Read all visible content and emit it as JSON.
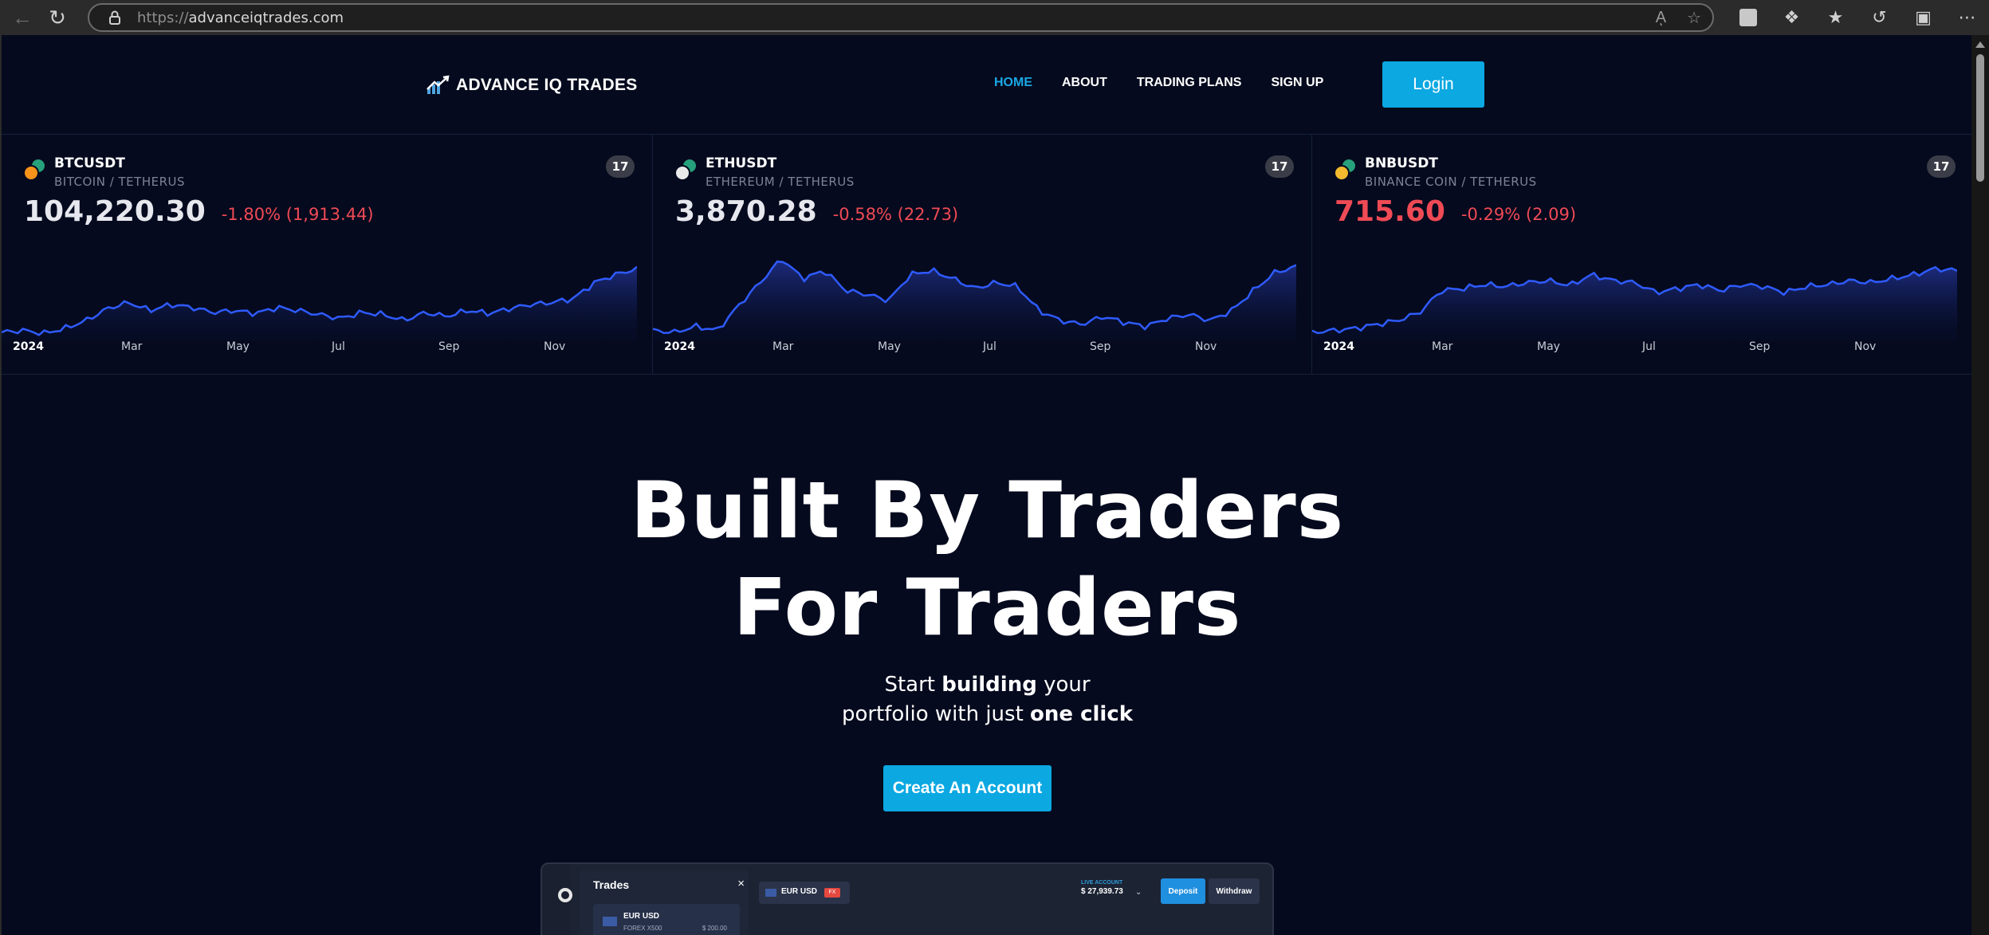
{
  "browser": {
    "url_scheme": "https://",
    "url_host": "advanceiqtrades.com",
    "read_aloud_label": "Aͅ",
    "icons": [
      "back-icon",
      "refresh-icon",
      "lock-icon",
      "read-aloud-icon",
      "favorite-star-icon",
      "profile-icon",
      "extensions-icon",
      "favorites-icon",
      "history-icon",
      "screen-capture-icon",
      "more-icon"
    ]
  },
  "site": {
    "brand": "ADVANCE IQ TRADES",
    "nav": [
      "HOME",
      "ABOUT",
      "TRADING PLANS",
      "SIGN UP"
    ],
    "active_nav": "HOME",
    "login_label": "Login",
    "colors": {
      "accent": "#0ba8e2",
      "background": "#050a1e",
      "negative": "#ef4a55",
      "chart_line": "#2f5bff"
    }
  },
  "tickers": [
    {
      "symbol": "BTCUSDT",
      "subtitle": "BITCOIN / TETHERUS",
      "price": "104,220.30",
      "change": "-1.80% (1,913.44)",
      "price_color": "default",
      "coin_color": "#f7931a",
      "axis": [
        "2024",
        "Mar",
        "May",
        "Jul",
        "Sep",
        "Nov"
      ],
      "tv_label": "17"
    },
    {
      "symbol": "ETHUSDT",
      "subtitle": "ETHEREUM / TETHERUS",
      "price": "3,870.28",
      "change": "-0.58% (22.73)",
      "price_color": "default",
      "coin_color": "#eaeaea",
      "axis": [
        "2024",
        "Mar",
        "May",
        "Jul",
        "Sep",
        "Nov"
      ],
      "tv_label": "17"
    },
    {
      "symbol": "BNBUSDT",
      "subtitle": "BINANCE COIN / TETHERUS",
      "price": "715.60",
      "change": "-0.29% (2.09)",
      "price_color": "red",
      "coin_color": "#f3ba2f",
      "axis": [
        "2024",
        "Mar",
        "May",
        "Jul",
        "Sep",
        "Nov"
      ],
      "tv_label": "17"
    }
  ],
  "hero": {
    "title_line1": "Built By Traders",
    "title_line2": "For Traders",
    "sub_line1_a": "Start ",
    "sub_line1_b": "building",
    "sub_line1_c": " your",
    "sub_line2_a": "portfolio with just ",
    "sub_line2_b": "one click",
    "cta_label": "Create An Account"
  },
  "preview": {
    "trades_title": "Trades",
    "close_glyph": "×",
    "trade_pair": "EUR USD",
    "trade_kind": "FOREX X500",
    "trade_amount": "$ 200.00",
    "pair_chip": "EUR USD",
    "pair_badge": "FX",
    "account_label": "LIVE ACCOUNT",
    "account_value": "$ 27,939.73",
    "deposit_label": "Deposit",
    "withdraw_label": "Withdraw"
  }
}
